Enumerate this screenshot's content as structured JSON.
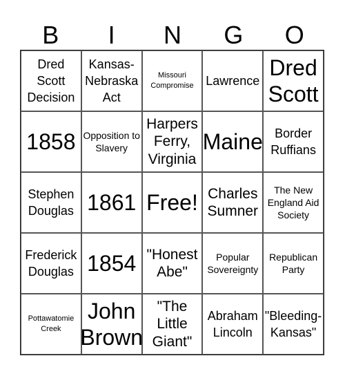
{
  "header": [
    "B",
    "I",
    "N",
    "G",
    "O"
  ],
  "cells": [
    [
      {
        "text": "Dred Scott Decision",
        "size": "s-md"
      },
      {
        "text": "Kansas-Nebraska Act",
        "size": "s-md"
      },
      {
        "text": "Missouri Compromise",
        "size": "s-xs"
      },
      {
        "text": "Lawrence",
        "size": "s-md"
      },
      {
        "text": "Dred Scott",
        "size": "s-xl"
      }
    ],
    [
      {
        "text": "1858",
        "size": "s-xl"
      },
      {
        "text": "Opposition to Slavery",
        "size": "s-sm"
      },
      {
        "text": "Harpers Ferry, Virginia",
        "size": "s-lg"
      },
      {
        "text": "Maine",
        "size": "s-xl"
      },
      {
        "text": "Border Ruffians",
        "size": "s-md"
      }
    ],
    [
      {
        "text": "Stephen Douglas",
        "size": "s-md"
      },
      {
        "text": "1861",
        "size": "s-xl"
      },
      {
        "text": "Free!",
        "size": "s-xl"
      },
      {
        "text": "Charles Sumner",
        "size": "s-lg"
      },
      {
        "text": "The New England Aid Society",
        "size": "s-sm"
      }
    ],
    [
      {
        "text": "Frederick Douglas",
        "size": "s-md"
      },
      {
        "text": "1854",
        "size": "s-xl"
      },
      {
        "text": "\"Honest Abe\"",
        "size": "s-lg"
      },
      {
        "text": "Popular Sovereignty",
        "size": "s-sm"
      },
      {
        "text": "Republican Party",
        "size": "s-sm"
      }
    ],
    [
      {
        "text": "Pottawatomie Creek",
        "size": "s-xs"
      },
      {
        "text": "John Brown",
        "size": "s-xl"
      },
      {
        "text": "\"The Little Giant\"",
        "size": "s-lg"
      },
      {
        "text": "Abraham Lincoln",
        "size": "s-md"
      },
      {
        "text": "\"Bleeding-Kansas\"",
        "size": "s-md"
      }
    ]
  ]
}
